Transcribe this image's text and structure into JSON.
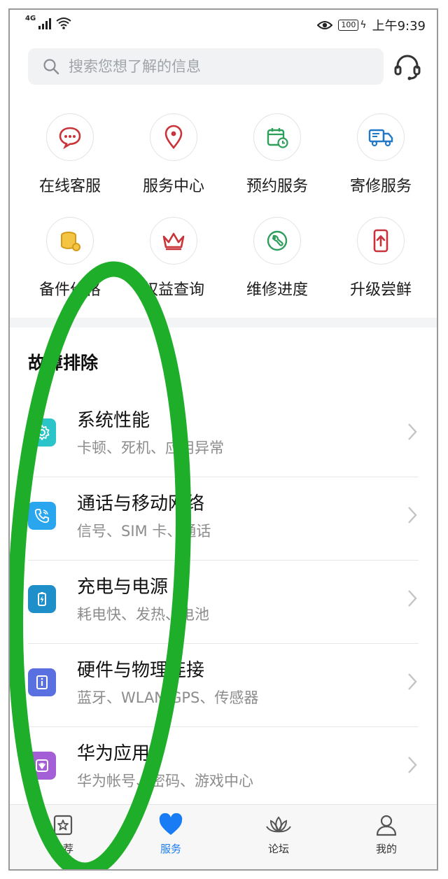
{
  "status_bar": {
    "network": "4G",
    "battery": "100",
    "time": "上午9:39"
  },
  "search": {
    "placeholder": "搜索您想了解的信息"
  },
  "services": [
    {
      "label": "在线客服",
      "icon": "chat-bubble-icon"
    },
    {
      "label": "服务中心",
      "icon": "location-pin-icon"
    },
    {
      "label": "预约服务",
      "icon": "calendar-clock-icon"
    },
    {
      "label": "寄修服务",
      "icon": "delivery-truck-icon"
    },
    {
      "label": "备件价格",
      "icon": "coin-stack-icon"
    },
    {
      "label": "权益查询",
      "icon": "crown-icon"
    },
    {
      "label": "维修进度",
      "icon": "wrench-icon"
    },
    {
      "label": "升级尝鲜",
      "icon": "phone-upgrade-icon"
    }
  ],
  "troubleshooting": {
    "title": "故障排除",
    "items": [
      {
        "title": "系统性能",
        "subtitle": "卡顿、死机、应用异常",
        "icon": "gear-icon",
        "color": "#2bc4c9"
      },
      {
        "title": "通话与移动网络",
        "subtitle": "信号、SIM 卡、通话",
        "icon": "phone-signal-icon",
        "color": "#2aa6ef"
      },
      {
        "title": "充电与电源",
        "subtitle": "耗电快、发热、电池",
        "icon": "battery-charge-icon",
        "color": "#1f8fc9"
      },
      {
        "title": "硬件与物理连接",
        "subtitle": "蓝牙、WLAN/GPS、传感器",
        "icon": "info-card-icon",
        "color": "#5a6fe0"
      },
      {
        "title": "华为应用",
        "subtitle": "华为帐号、密码、游戏中心",
        "icon": "huawei-app-icon",
        "color": "#a45fd6"
      }
    ]
  },
  "nav": {
    "tabs": [
      {
        "label": "推荐",
        "icon": "star-card-icon",
        "active": false
      },
      {
        "label": "服务",
        "icon": "heart-icon",
        "active": true
      },
      {
        "label": "论坛",
        "icon": "lotus-icon",
        "active": false
      },
      {
        "label": "我的",
        "icon": "person-icon",
        "active": false
      }
    ]
  },
  "colors": {
    "accent": "#1a7cf5",
    "service_icon_red": "#c9343a",
    "service_icon_green": "#2e9e5b",
    "annotation": "#1fae2a"
  }
}
